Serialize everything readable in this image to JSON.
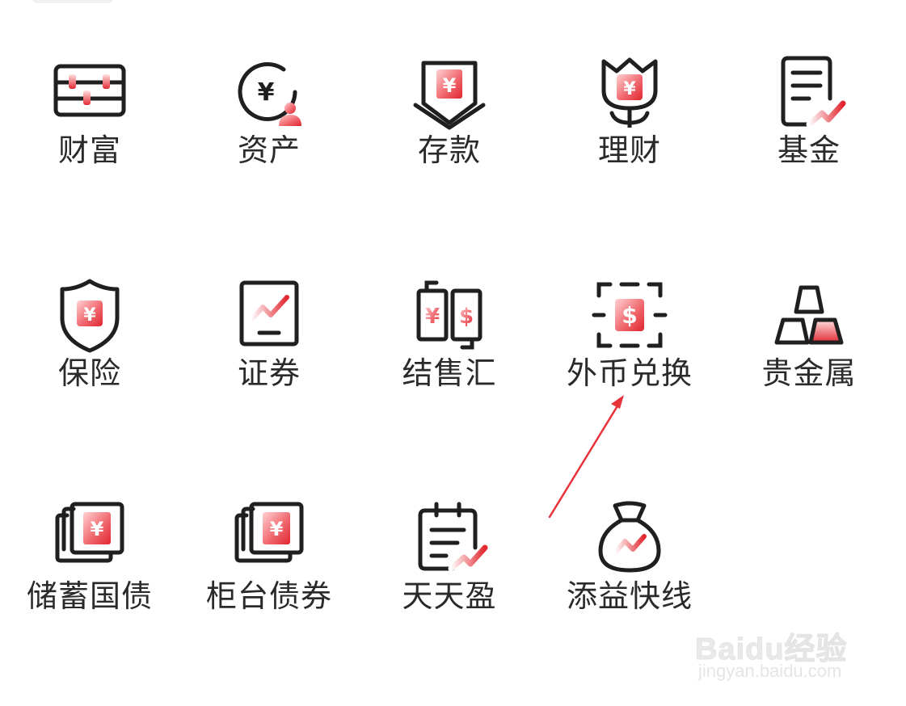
{
  "services": [
    {
      "id": "wealth",
      "label": "财富",
      "icon": "abacus-icon"
    },
    {
      "id": "assets",
      "label": "资产",
      "icon": "yuan-person-icon"
    },
    {
      "id": "deposit",
      "label": "存款",
      "icon": "yuan-deposit-arrow-icon"
    },
    {
      "id": "finance",
      "label": "理财",
      "icon": "yuan-flower-icon"
    },
    {
      "id": "fund",
      "label": "基金",
      "icon": "document-trend-icon"
    },
    {
      "id": "insurance",
      "label": "保险",
      "icon": "yuan-shield-icon"
    },
    {
      "id": "securities",
      "label": "证券",
      "icon": "trend-board-icon"
    },
    {
      "id": "fx_settlement",
      "label": "结售汇",
      "icon": "yuan-dollar-exchange-icon"
    },
    {
      "id": "fx_exchange",
      "label": "外币兑换",
      "icon": "dollar-scan-icon"
    },
    {
      "id": "precious_metals",
      "label": "贵金属",
      "icon": "gold-bars-icon"
    },
    {
      "id": "savings_bonds",
      "label": "储蓄国债",
      "icon": "yuan-notes-stack-icon"
    },
    {
      "id": "counter_bonds",
      "label": "柜台债券",
      "icon": "yuan-notes-stack-icon"
    },
    {
      "id": "tiantianying",
      "label": "天天盈",
      "icon": "calendar-trend-icon"
    },
    {
      "id": "tianyi_express",
      "label": "添益快线",
      "icon": "money-bag-trend-icon"
    }
  ],
  "annotation": {
    "type": "red-arrow",
    "target": "外币兑换"
  },
  "watermark": {
    "brand": "Baidu经验",
    "url": "jingyan.baidu.com"
  },
  "colors": {
    "accent_red": "#e8333b",
    "stroke": "#1f1f1f",
    "label": "#2a2a2a"
  }
}
